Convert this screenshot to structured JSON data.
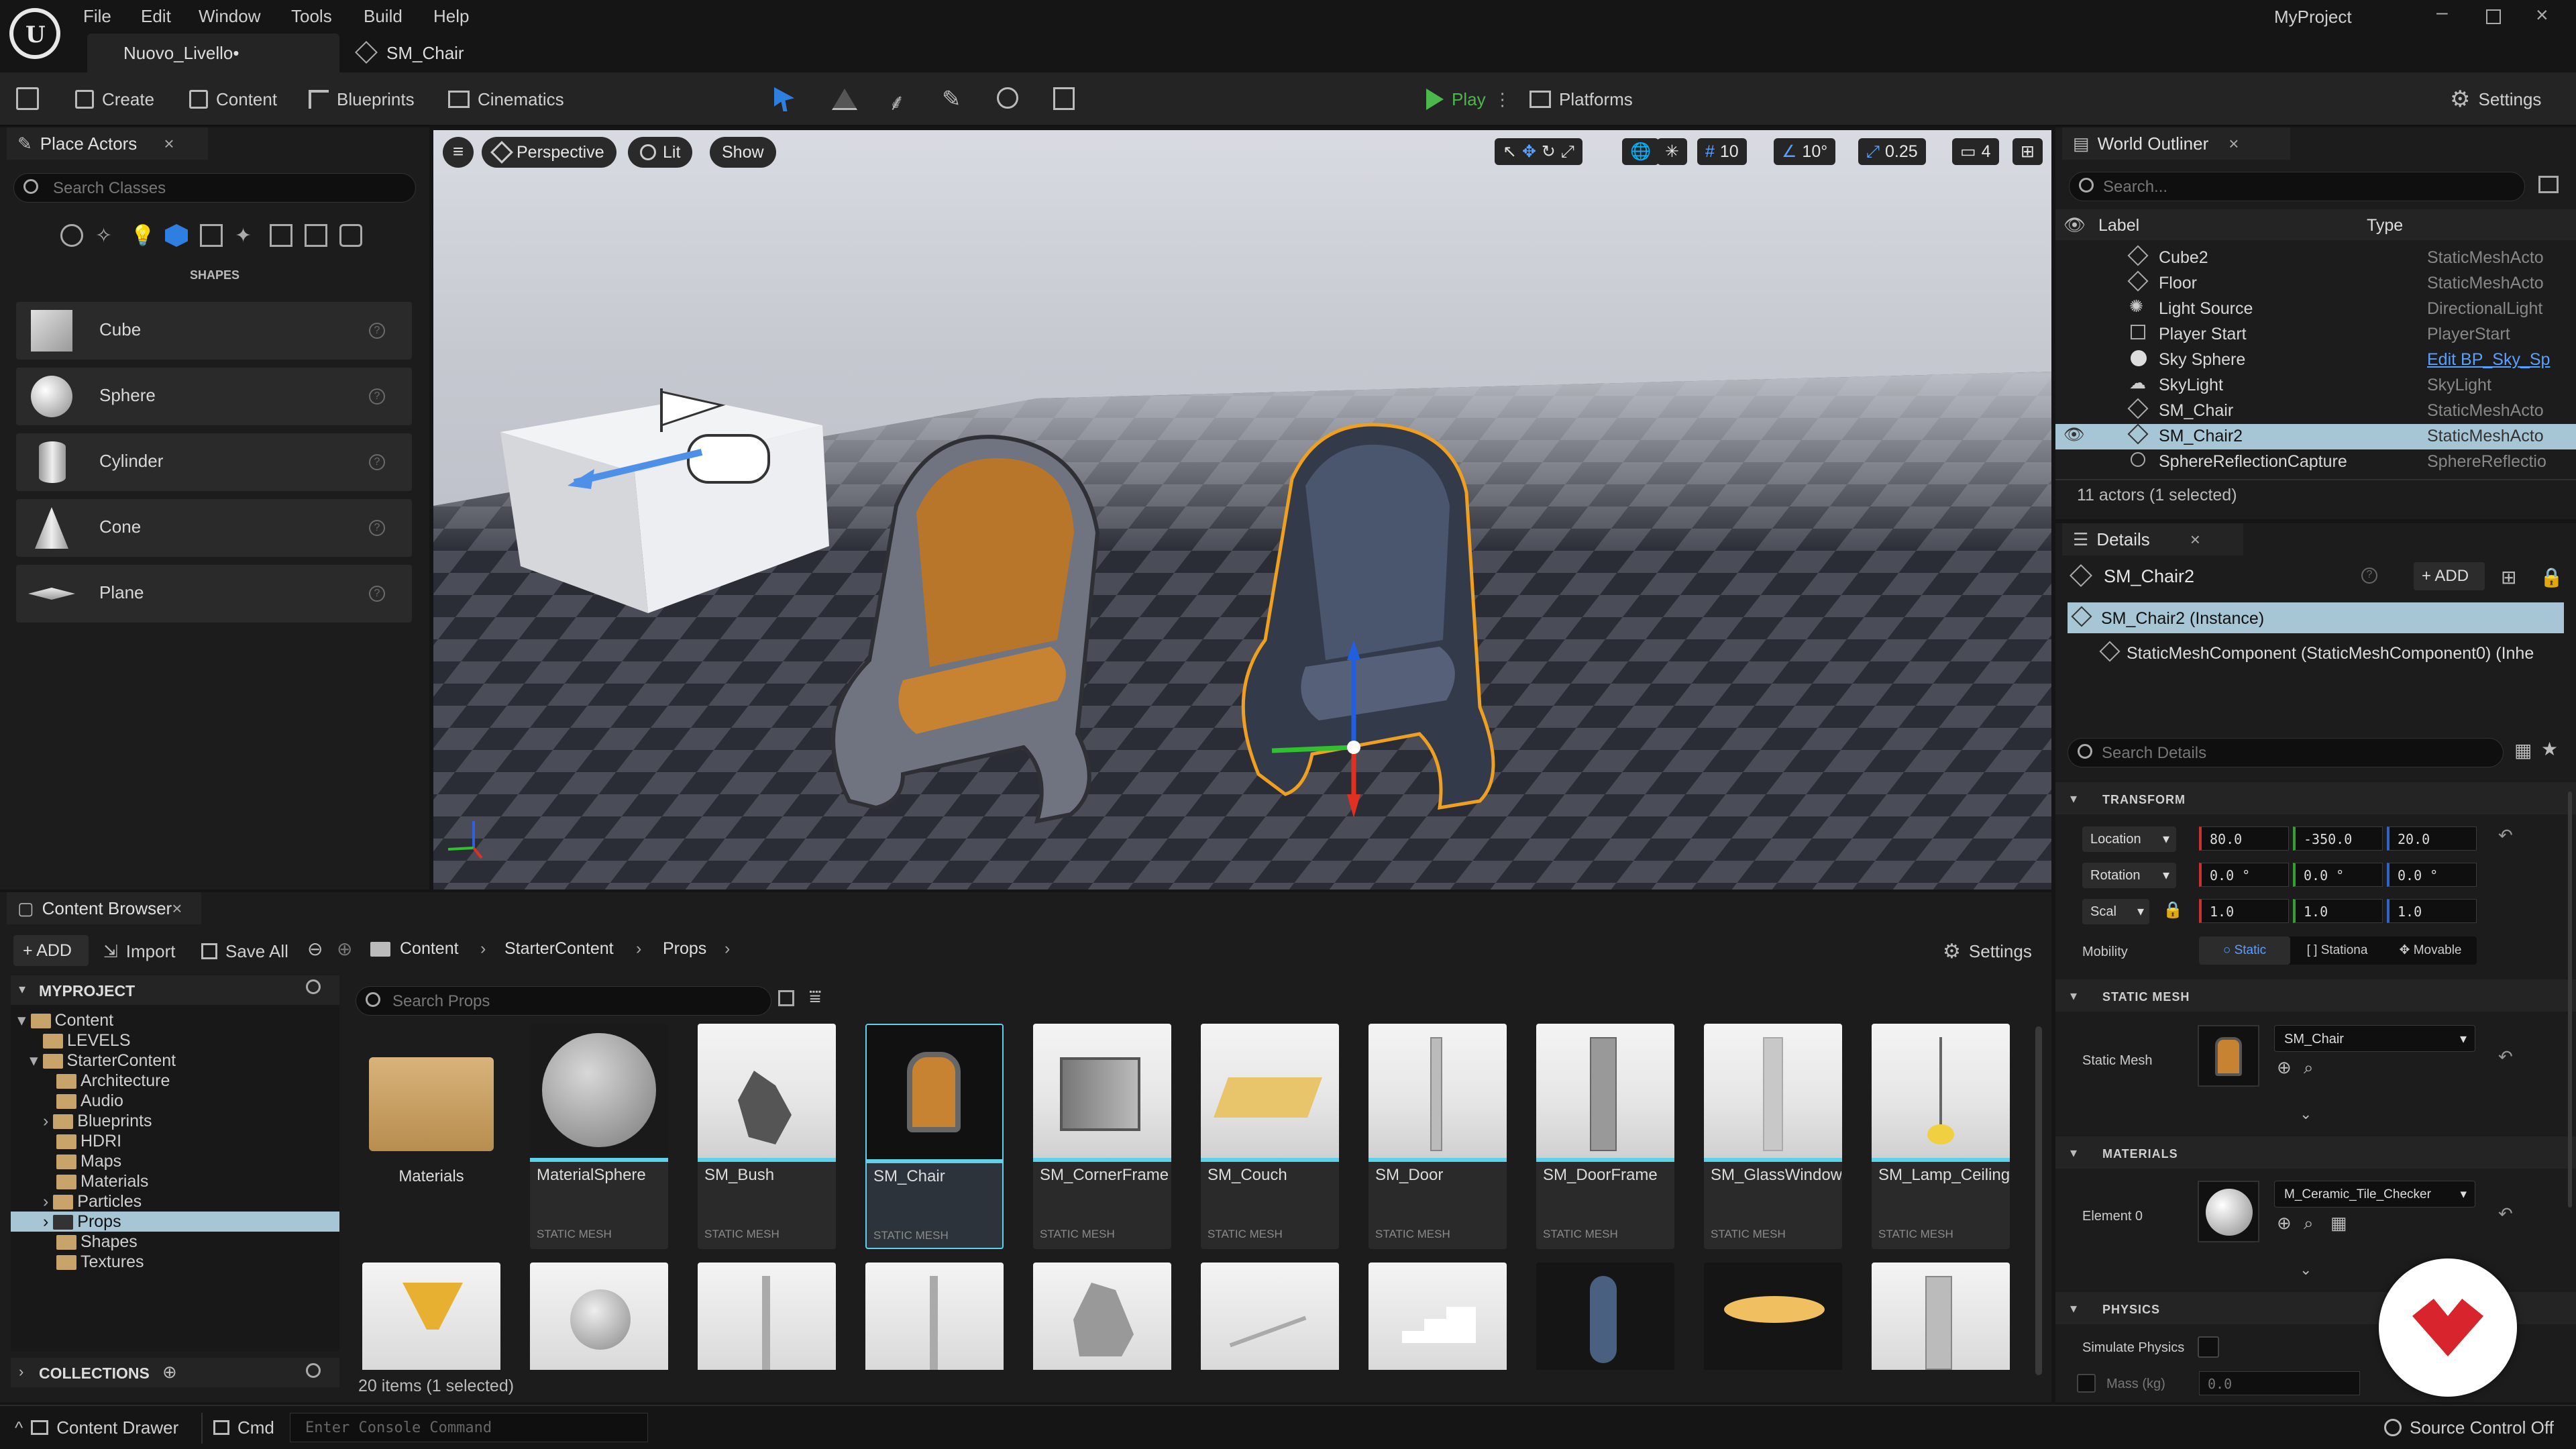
{
  "menu": [
    "File",
    "Edit",
    "Window",
    "Tools",
    "Build",
    "Help"
  ],
  "project_name": "MyProject",
  "tabs": {
    "level": "Nuovo_Livello•",
    "asset": "SM_Chair"
  },
  "toolbar": {
    "create": "Create",
    "content": "Content",
    "blueprints": "Blueprints",
    "cinematics": "Cinematics",
    "play": "Play",
    "platforms": "Platforms",
    "settings": "Settings"
  },
  "place_actors": {
    "title": "Place Actors",
    "search_placeholder": "Search Classes",
    "category": "SHAPES",
    "items": [
      "Cube",
      "Sphere",
      "Cylinder",
      "Cone",
      "Plane"
    ]
  },
  "viewport": {
    "perspective": "Perspective",
    "lit": "Lit",
    "show": "Show",
    "grid_snap": "10",
    "rot_snap": "10°",
    "scale_snap": "0.25",
    "camera_speed": "4"
  },
  "outliner": {
    "title": "World Outliner",
    "search_placeholder": "Search...",
    "col_label": "Label",
    "col_type": "Type",
    "rows": [
      {
        "label": "Cube2",
        "type": "StaticMeshActo"
      },
      {
        "label": "Floor",
        "type": "StaticMeshActo"
      },
      {
        "label": "Light Source",
        "type": "DirectionalLight"
      },
      {
        "label": "Player Start",
        "type": "PlayerStart"
      },
      {
        "label": "Sky Sphere",
        "type": "Edit BP_Sky_Sp"
      },
      {
        "label": "SkyLight",
        "type": "SkyLight"
      },
      {
        "label": "SM_Chair",
        "type": "StaticMeshActo"
      },
      {
        "label": "SM_Chair2",
        "type": "StaticMeshActo"
      },
      {
        "label": "SphereReflectionCapture",
        "type": "SphereReflectio"
      }
    ],
    "status": "11 actors (1 selected)"
  },
  "details": {
    "title": "Details",
    "object_name": "SM_Chair2",
    "add": "ADD",
    "instance": "SM_Chair2 (Instance)",
    "component": "StaticMeshComponent (StaticMeshComponent0) (Inhe",
    "search_placeholder": "Search Details",
    "transform": {
      "title": "TRANSFORM",
      "location_label": "Location",
      "location": [
        "80.0",
        "-350.0",
        "20.0"
      ],
      "rotation_label": "Rotation",
      "rotation": [
        "0.0 °",
        "0.0 °",
        "0.0 °"
      ],
      "scale_label": "Scal",
      "scale": [
        "1.0",
        "1.0",
        "1.0"
      ],
      "mobility_label": "Mobility",
      "mobility": [
        "Static",
        "Stationa",
        "Movable"
      ]
    },
    "static_mesh": {
      "title": "STATIC MESH",
      "label": "Static Mesh",
      "value": "SM_Chair"
    },
    "materials": {
      "title": "MATERIALS",
      "label": "Element 0",
      "value": "M_Ceramic_Tile_Checker"
    },
    "physics": {
      "title": "PHYSICS",
      "simulate": "Simulate Physics",
      "mass": "Mass (kg)",
      "mass_value": "0.0"
    }
  },
  "content_browser": {
    "title": "Content Browser",
    "add": "ADD",
    "import": "Import",
    "save_all": "Save All",
    "breadcrumb": [
      "Content",
      "StarterContent",
      "Props"
    ],
    "settings": "Settings",
    "project": "MYPROJECT",
    "tree": [
      "Content",
      "LEVELS",
      "StarterContent",
      "Architecture",
      "Audio",
      "Blueprints",
      "HDRI",
      "Maps",
      "Materials",
      "Particles",
      "Props",
      "Shapes",
      "Textures"
    ],
    "collections": "COLLECTIONS",
    "search_placeholder": "Search Props",
    "folder": "Materials",
    "assets": [
      {
        "name": "MaterialSphere",
        "type": "STATIC MESH"
      },
      {
        "name": "SM_Bush",
        "type": "STATIC MESH"
      },
      {
        "name": "SM_Chair",
        "type": "STATIC MESH"
      },
      {
        "name": "SM_CornerFrame",
        "type": "STATIC MESH"
      },
      {
        "name": "SM_Couch",
        "type": "STATIC MESH"
      },
      {
        "name": "SM_Door",
        "type": "STATIC MESH"
      },
      {
        "name": "SM_DoorFrame",
        "type": "STATIC MESH"
      },
      {
        "name": "SM_GlassWindow",
        "type": "STATIC MESH"
      },
      {
        "name": "SM_Lamp_Ceiling",
        "type": "STATIC MESH"
      }
    ],
    "status": "20 items (1 selected)"
  },
  "bottom_bar": {
    "content_drawer": "Content Drawer",
    "cmd": "Cmd",
    "console_placeholder": "Enter Console Command",
    "source_control": "Source Control Off"
  },
  "colors": {
    "accent": "#0070e0",
    "selection": "#a6c6d6",
    "play": "#4cb84c",
    "cyan": "#5fd1e8"
  }
}
